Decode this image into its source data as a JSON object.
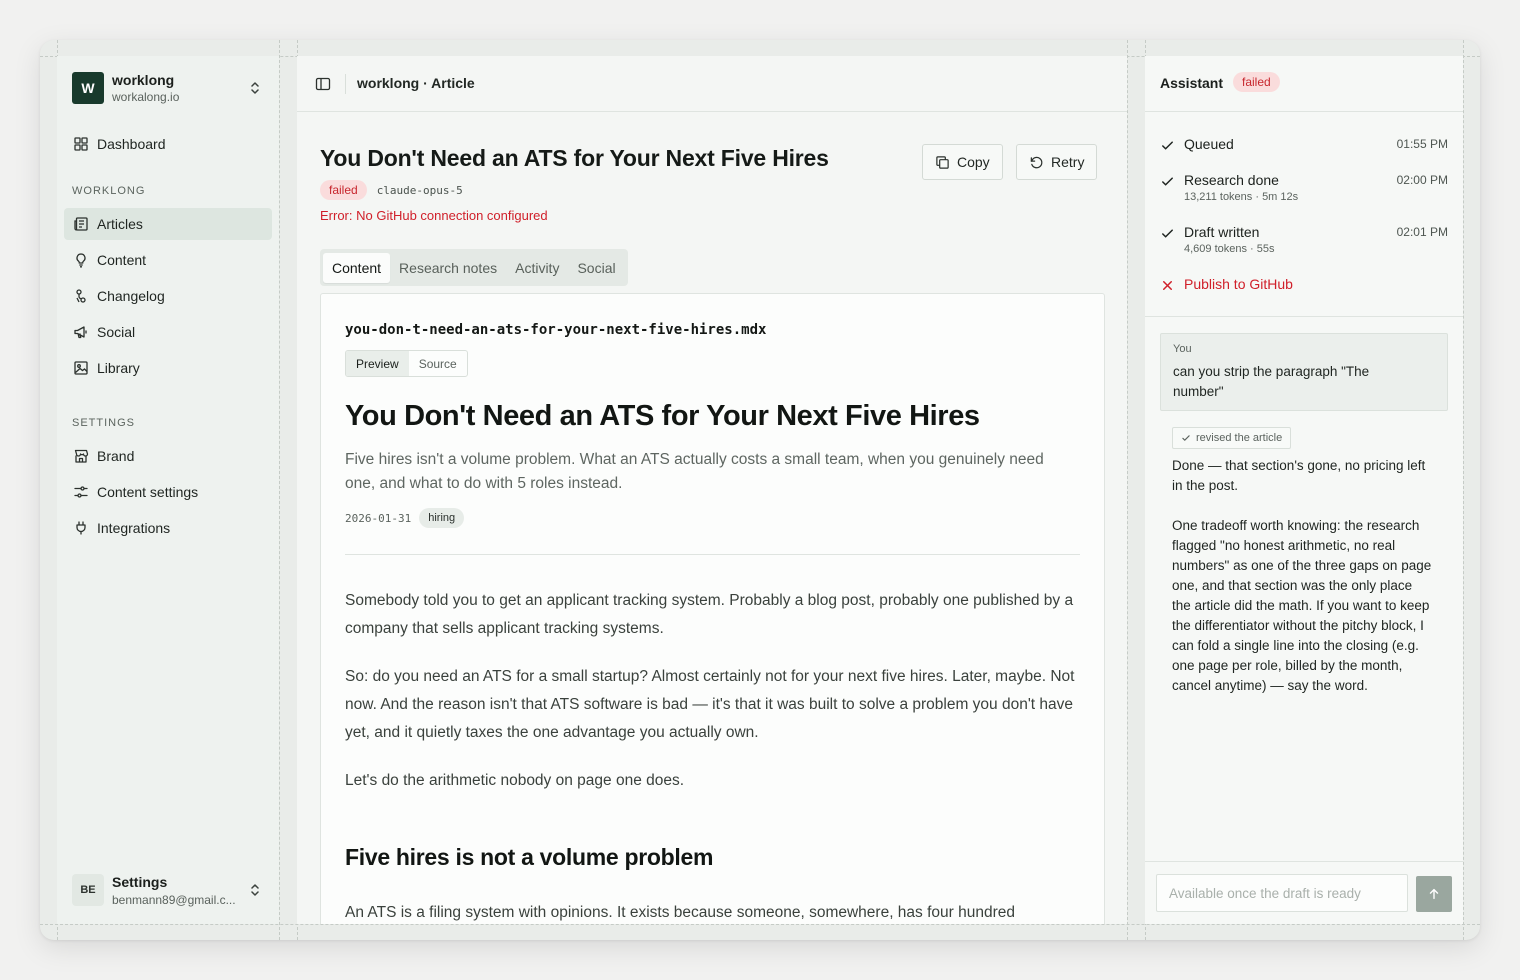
{
  "workspace": {
    "initial": "W",
    "name": "worklong",
    "domain": "workalong.io"
  },
  "sidebar": {
    "dashboard": "Dashboard",
    "section_worklong": "WORKLONG",
    "items": [
      {
        "label": "Articles",
        "icon": "newspaper-icon",
        "active": true
      },
      {
        "label": "Content",
        "icon": "lightbulb-icon"
      },
      {
        "label": "Changelog",
        "icon": "git-commit-icon"
      },
      {
        "label": "Social",
        "icon": "megaphone-icon"
      },
      {
        "label": "Library",
        "icon": "image-icon"
      }
    ],
    "section_settings": "SETTINGS",
    "settings_items": [
      {
        "label": "Brand",
        "icon": "store-icon"
      },
      {
        "label": "Content settings",
        "icon": "sliders-icon"
      },
      {
        "label": "Integrations",
        "icon": "plug-icon"
      }
    ],
    "user": {
      "initials": "BE",
      "name": "Settings",
      "email": "benmann89@gmail.c..."
    }
  },
  "main": {
    "breadcrumb": "worklong · Article",
    "title": "You Don't Need an ATS for Your Next Five Hires",
    "status": "failed",
    "model": "claude-opus-5",
    "error": "Error: No GitHub connection configured",
    "copy_label": "Copy",
    "retry_label": "Retry",
    "tabs": [
      "Content",
      "Research notes",
      "Activity",
      "Social"
    ],
    "active_tab": "Content",
    "doc": {
      "filename": "you-don-t-need-an-ats-for-your-next-five-hires.mdx",
      "view_modes": [
        "Preview",
        "Source"
      ],
      "active_view": "Preview",
      "heading": "You Don't Need an ATS for Your Next Five Hires",
      "lead": "Five hires isn't a volume problem. What an ATS actually costs a small team, when you genuinely need one, and what to do with 5 roles instead.",
      "date": "2026-01-31",
      "tag": "hiring",
      "paragraphs": [
        "Somebody told you to get an applicant tracking system. Probably a blog post, probably one published by a company that sells applicant tracking systems.",
        "So: do you need an ATS for a small startup? Almost certainly not for your next five hires. Later, maybe. Not now. And the reason isn't that ATS software is bad — it's that it was built to solve a problem you don't have yet, and it quietly taxes the one advantage you actually own.",
        "Let's do the arithmetic nobody on page one does."
      ],
      "h2": "Five hires is not a volume problem",
      "para_after_h2": "An ATS is a filing system with opinions. It exists because someone, somewhere, has four hundred"
    }
  },
  "assistant": {
    "title": "Assistant",
    "status": "failed",
    "steps": [
      {
        "label": "Queued",
        "time": "01:55 PM",
        "sub": ""
      },
      {
        "label": "Research done",
        "time": "02:00 PM",
        "sub": "13,211 tokens · 5m 12s"
      },
      {
        "label": "Draft written",
        "time": "02:01 PM",
        "sub": "4,609 tokens · 55s"
      },
      {
        "label": "Publish to GitHub",
        "time": "",
        "sub": ""
      }
    ],
    "user_label": "You",
    "user_message": "can you strip the paragraph \"The number\"",
    "revised_label": "revised the article",
    "reply": [
      "Done — that section's gone, no pricing left in the post.",
      "One tradeoff worth knowing: the research flagged \"no honest arithmetic, no real numbers\" as one of the three gaps on page one, and that section was the only place the article did the math. If you want to keep the differentiator without the pitchy block, I can fold a single line into the closing (e.g. one page per role, billed by the month, cancel anytime) — say the word."
    ],
    "composer_placeholder": "Available once the draft is ready"
  },
  "colors": {
    "accent": "#183a2c",
    "error": "#d0202a",
    "failed_bg": "#fadcdc"
  }
}
